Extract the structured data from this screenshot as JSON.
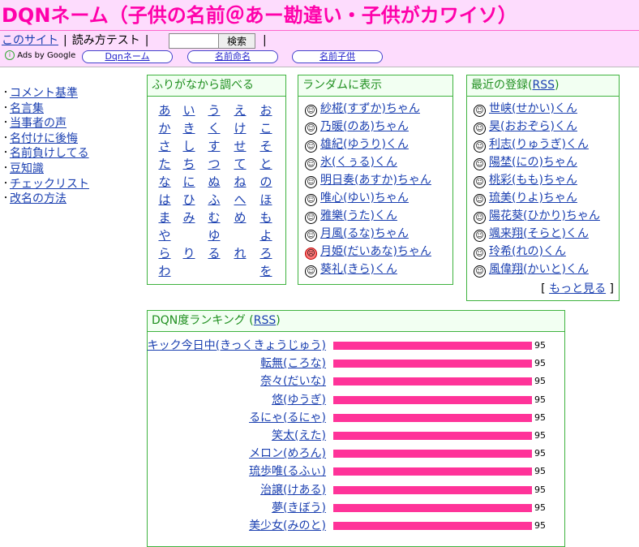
{
  "header": {
    "title": "DQNネーム（子供の名前＠あー勘違い・子供がカワイソ）",
    "nav_site": "このサイト",
    "nav_reading_test": "読み方テスト",
    "search_button": "検索",
    "search_value": "",
    "ads_label": "Ads by Google",
    "ad_links": [
      "Dqnネーム",
      "名前命名",
      "名前子供"
    ]
  },
  "sidebar": {
    "items": [
      "コメント基準",
      "名言集",
      "当事者の声",
      "名付けに後悔",
      "名前負けしてる",
      "豆知識",
      "チェックリスト",
      "改名の方法"
    ]
  },
  "kana_box": {
    "title": "ふりがなから調べる",
    "columns": [
      [
        "あ",
        "か",
        "さ",
        "た",
        "な",
        "は",
        "ま",
        "や",
        "ら",
        "わ"
      ],
      [
        "い",
        "き",
        "し",
        "ち",
        "に",
        "ひ",
        "み",
        "",
        "り",
        ""
      ],
      [
        "う",
        "く",
        "す",
        "つ",
        "ぬ",
        "ふ",
        "む",
        "ゆ",
        "る",
        ""
      ],
      [
        "え",
        "け",
        "せ",
        "て",
        "ね",
        "へ",
        "め",
        "",
        "れ",
        ""
      ],
      [
        "お",
        "こ",
        "そ",
        "と",
        "の",
        "ほ",
        "も",
        "よ",
        "ろ",
        "を"
      ]
    ]
  },
  "random_box": {
    "title": "ランダムに表示",
    "items": [
      {
        "name": "紗椛(すずか)ちゃん",
        "face": "smile"
      },
      {
        "name": "乃暖(のあ)ちゃん",
        "face": "smile"
      },
      {
        "name": "雄紀(ゆうり)くん",
        "face": "smile"
      },
      {
        "name": "氷(くぅる)くん",
        "face": "smile"
      },
      {
        "name": "明日奏(あすか)ちゃん",
        "face": "smile"
      },
      {
        "name": "唯心(ゆい)ちゃん",
        "face": "smile"
      },
      {
        "name": "雅樂(うた)くん",
        "face": "smile"
      },
      {
        "name": "月風(るな)ちゃん",
        "face": "smile"
      },
      {
        "name": "月姫(だいあな)ちゃん",
        "face": "angry"
      },
      {
        "name": "葵礼(きら)くん",
        "face": "smile"
      }
    ]
  },
  "recent_box": {
    "title": "最近の登録",
    "rss": "RSS",
    "items": [
      {
        "name": "世峡(せかい)くん"
      },
      {
        "name": "昊(おおぞら)くん"
      },
      {
        "name": "利志(りゅうぎ)くん"
      },
      {
        "name": "陽埜(にの)ちゃん"
      },
      {
        "name": "桃彩(もも)ちゃん"
      },
      {
        "name": "琉美(りよ)ちゃん"
      },
      {
        "name": "陽花葵(ひかり)ちゃん"
      },
      {
        "name": "颯来翔(そらと)くん"
      },
      {
        "name": "玲希(れの)くん"
      },
      {
        "name": "風偉翔(かいと)くん"
      }
    ],
    "more": "もっと見る"
  },
  "ranking_box": {
    "title": "DQN度ランキング",
    "rss": "RSS",
    "rows": [
      {
        "name": "キック今日中(きっくきょうじゅう)",
        "score": 95
      },
      {
        "name": "転無(ころな)",
        "score": 95
      },
      {
        "name": "奈々(だいな)",
        "score": 95
      },
      {
        "name": "悠(ゆうぎ)",
        "score": 95
      },
      {
        "name": "るにゃ(るにゃ)",
        "score": 95
      },
      {
        "name": "笑太(えた)",
        "score": 95
      },
      {
        "name": "メロン(めろん)",
        "score": 95
      },
      {
        "name": "琉歩唯(るふぃ)",
        "score": 95
      },
      {
        "name": "治譲(けある)",
        "score": 95
      },
      {
        "name": "夢(きぼう)",
        "score": 95
      },
      {
        "name": "美少女(みのと)",
        "score": 95
      }
    ]
  }
}
